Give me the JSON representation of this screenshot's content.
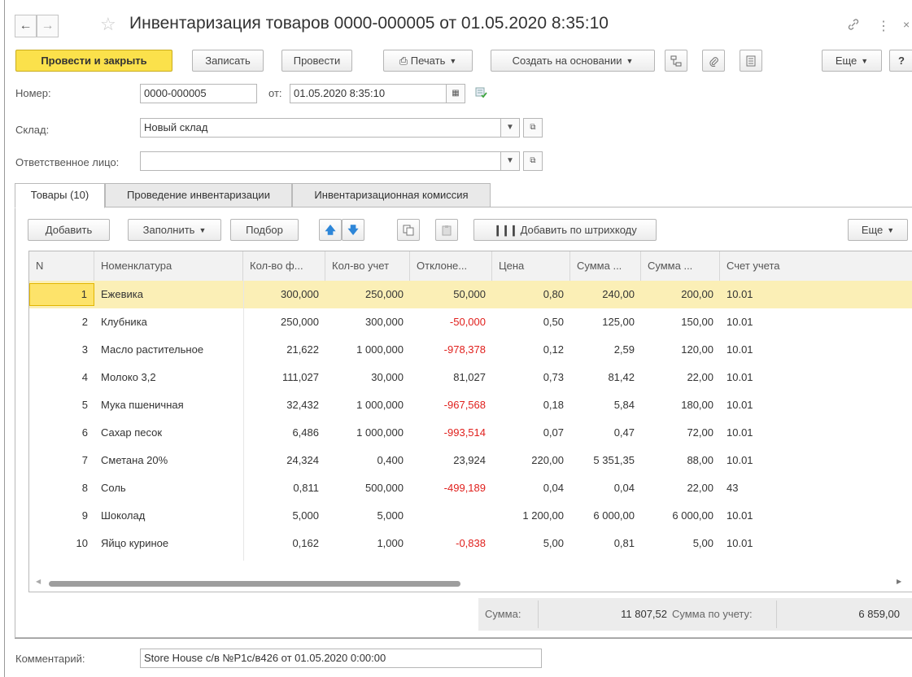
{
  "window": {
    "title": "Инвентаризация товаров 0000-000005 от 01.05.2020 8:35:10",
    "back_icon": "arrow-left-icon",
    "forward_icon": "arrow-right-icon",
    "favorite_icon": "star-icon",
    "link_icon": "link-icon",
    "menu_icon": "kebab-menu-icon",
    "close_label": "×"
  },
  "toolbar": {
    "post_close": "Провести и закрыть",
    "save": "Записать",
    "post": "Провести",
    "print": "Печать",
    "create_based": "Создать на основании",
    "more": "Еще",
    "help": "?"
  },
  "form": {
    "number_label": "Номер:",
    "number_value": "0000-000005",
    "date_label": "от:",
    "date_value": "01.05.2020  8:35:10",
    "warehouse_label": "Склад:",
    "warehouse_value": "Новый склад",
    "responsible_label": "Ответственное лицо:",
    "responsible_value": "",
    "comment_label": "Комментарий:",
    "comment_value": "Store House с/в №P1c/в426 от 01.05.2020 0:00:00"
  },
  "tabs": [
    {
      "label": "Товары (10)",
      "active": true
    },
    {
      "label": "Проведение инвентаризации",
      "active": false
    },
    {
      "label": "Инвентаризационная комиссия",
      "active": false
    }
  ],
  "table_toolbar": {
    "add": "Добавить",
    "fill": "Заполнить",
    "pick": "Подбор",
    "barcode": "Добавить по штрихкоду",
    "more": "Еще"
  },
  "table": {
    "columns": [
      "N",
      "Номенклатура",
      "Кол-во ф...",
      "Кол-во учет",
      "Отклоне...",
      "Цена",
      "Сумма ...",
      "Сумма ...",
      "Счет учета"
    ],
    "rows": [
      {
        "n": "1",
        "name": "Ежевика",
        "qf": "300,000",
        "qu": "250,000",
        "dev": "50,000",
        "price": "0,80",
        "s1": "240,00",
        "s2": "200,00",
        "acc": "10.01",
        "neg": false
      },
      {
        "n": "2",
        "name": "Клубника",
        "qf": "250,000",
        "qu": "300,000",
        "dev": "-50,000",
        "price": "0,50",
        "s1": "125,00",
        "s2": "150,00",
        "acc": "10.01",
        "neg": true
      },
      {
        "n": "3",
        "name": "Масло растительное",
        "qf": "21,622",
        "qu": "1 000,000",
        "dev": "-978,378",
        "price": "0,12",
        "s1": "2,59",
        "s2": "120,00",
        "acc": "10.01",
        "neg": true
      },
      {
        "n": "4",
        "name": "Молоко 3,2",
        "qf": "111,027",
        "qu": "30,000",
        "dev": "81,027",
        "price": "0,73",
        "s1": "81,42",
        "s2": "22,00",
        "acc": "10.01",
        "neg": false
      },
      {
        "n": "5",
        "name": "Мука пшеничная",
        "qf": "32,432",
        "qu": "1 000,000",
        "dev": "-967,568",
        "price": "0,18",
        "s1": "5,84",
        "s2": "180,00",
        "acc": "10.01",
        "neg": true
      },
      {
        "n": "6",
        "name": "Сахар песок",
        "qf": "6,486",
        "qu": "1 000,000",
        "dev": "-993,514",
        "price": "0,07",
        "s1": "0,47",
        "s2": "72,00",
        "acc": "10.01",
        "neg": true
      },
      {
        "n": "7",
        "name": "Сметана 20%",
        "qf": "24,324",
        "qu": "0,400",
        "dev": "23,924",
        "price": "220,00",
        "s1": "5 351,35",
        "s2": "88,00",
        "acc": "10.01",
        "neg": false
      },
      {
        "n": "8",
        "name": "Соль",
        "qf": "0,811",
        "qu": "500,000",
        "dev": "-499,189",
        "price": "0,04",
        "s1": "0,04",
        "s2": "22,00",
        "acc": "43",
        "neg": true
      },
      {
        "n": "9",
        "name": "Шоколад",
        "qf": "5,000",
        "qu": "5,000",
        "dev": "",
        "price": "1 200,00",
        "s1": "6 000,00",
        "s2": "6 000,00",
        "acc": "10.01",
        "neg": false
      },
      {
        "n": "10",
        "name": "Яйцо куриное",
        "qf": "0,162",
        "qu": "1,000",
        "dev": "-0,838",
        "price": "5,00",
        "s1": "0,81",
        "s2": "5,00",
        "acc": "10.01",
        "neg": true
      }
    ]
  },
  "totals": {
    "sum_label": "Сумма:",
    "sum_value": "11 807,52",
    "acc_label": "Сумма по учету:",
    "acc_value": "6 859,00"
  },
  "colors": {
    "primary_button": "#fbe14b",
    "selected_row": "#fbefb6",
    "negative": "#e0201d"
  }
}
